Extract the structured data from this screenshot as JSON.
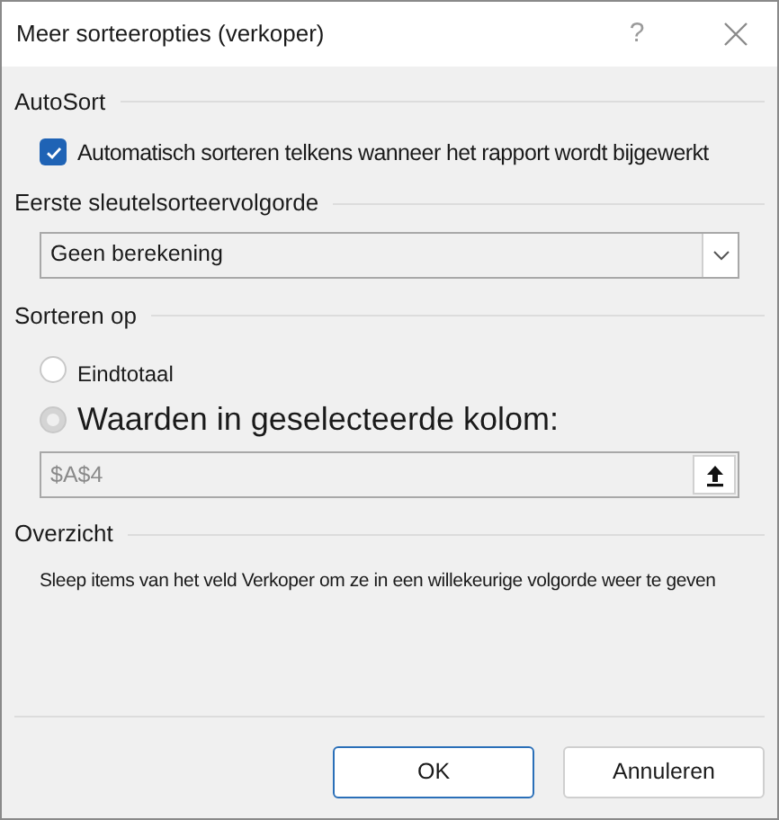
{
  "window": {
    "title": "Meer sorteeropties (verkoper)",
    "help": "?"
  },
  "autosort": {
    "heading": "AutoSort",
    "checkbox": {
      "label": "Automatisch sorteren telkens wanneer het rapport wordt bijgewerkt",
      "checked": true
    }
  },
  "first_key": {
    "heading": "Eerste sleutelsorteervolgorde",
    "dropdown": {
      "value": "Geen berekening"
    }
  },
  "sort_by": {
    "heading": "Sorteren op",
    "options": [
      {
        "label": "Eindtotaal",
        "selected": false
      },
      {
        "label": "Waarden in geselecteerde kolom:",
        "selected": false
      }
    ],
    "field": {
      "value": "$A$4",
      "disabled": true
    }
  },
  "summary": {
    "heading": "Overzicht",
    "text": "Sleep items van het veld Verkoper om ze in een willekeurige volgorde weer te geven"
  },
  "buttons": [
    {
      "label": "OK",
      "default": true
    },
    {
      "label": "Annuleren",
      "default": false
    }
  ]
}
